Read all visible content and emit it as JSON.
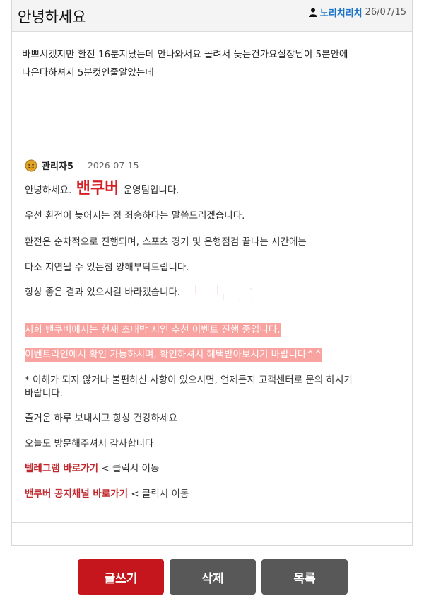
{
  "post": {
    "title": "안녕하세요",
    "author": "노리치리치",
    "date": "26/07/15",
    "body_line1": "바쁘시겠지만 환전 16분지났는데 안나와서요 몰려서 늦는건가요실장님이 5분안에",
    "body_line2": "나온다하셔서 5분컷인줄알았는데"
  },
  "reply": {
    "admin_name": "관리자5",
    "date": "2026-07-15",
    "greeting_pre": "안녕하세요.",
    "brand": "밴쿠버",
    "greeting_post": "운영팀입니다.",
    "line1": "우선 환전이 늦어지는 점 죄송하다는 말씀드리겠습니다.",
    "line2": "환전은 순차적으로 진행되며, 스포츠 경기 및 은행점검 끝나는 시간에는",
    "line3": "다소 지연될 수 있는점 양해부탁드립니다.",
    "line4": "항상 좋은 결과 있으시길 바라겠습니다.",
    "highlight1": "저희 밴쿠버에서는 현재 초대박 지인 추천 이벤트 진행 중입니다.",
    "highlight2": "이벤트라인에서 확인 가능하시며, 확인하셔서 혜택받아보시기 바랍니다^^",
    "note_line1": "* 이해가 되지 않거나 불편하신 사항이 있으시면, 언제든지 고객센터로 문의 하시기",
    "note_line2": "바랍니다.",
    "closing1": "즐거운 하루 보내시고 항상 건강하세요",
    "closing2": "오늘도 방문해주셔서 감사합니다",
    "link1_label": "텔레그램 바로가기",
    "link1_suffix": "< 클릭시 이동",
    "link2_label": "밴쿠버 공지채널 바로가기",
    "link2_suffix": "< 클릭시 이동"
  },
  "watermark": "토토콩",
  "buttons": {
    "write": "글쓰기",
    "delete": "삭제",
    "list": "목록"
  },
  "colors": {
    "brand_red": "#d71f24",
    "highlight": "#f9a3a0",
    "author_blue": "#1a73c8",
    "write_button": "#c4161c",
    "gray_button": "#585858"
  }
}
